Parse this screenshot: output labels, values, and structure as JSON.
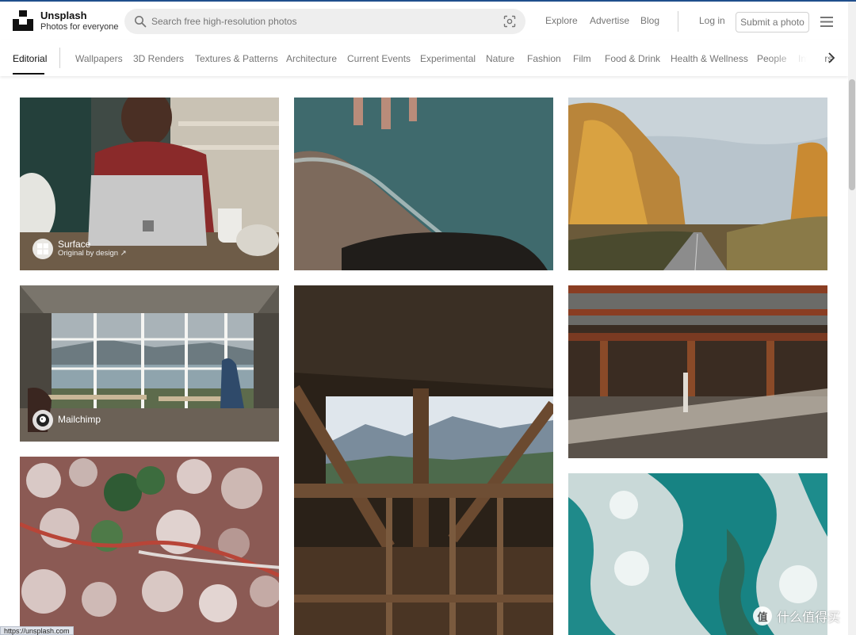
{
  "brand": {
    "name": "Unsplash",
    "tagline": "Photos for everyone"
  },
  "search": {
    "placeholder": "Search free high-resolution photos",
    "value": ""
  },
  "nav": {
    "explore": "Explore",
    "advertise": "Advertise",
    "blog": "Blog",
    "login": "Log in",
    "submit": "Submit a photo"
  },
  "topics": [
    "Editorial",
    "Wallpapers",
    "3D Renders",
    "Textures & Patterns",
    "Architecture",
    "Current Events",
    "Experimental",
    "Nature",
    "Fashion",
    "Film",
    "Food & Drink",
    "Health & Wellness",
    "People",
    "Interiors"
  ],
  "active_topic": "Editorial",
  "sponsors": {
    "surface": {
      "name": "Surface",
      "subtitle": "Original by design ↗"
    },
    "mailchimp": {
      "name": "Mailchimp"
    }
  },
  "photos": [
    {
      "name": "photo-surface-laptop",
      "sponsored": true
    },
    {
      "name": "photo-beach-water"
    },
    {
      "name": "photo-autumn-road"
    },
    {
      "name": "photo-mailchimp-office",
      "sponsored": true
    },
    {
      "name": "photo-wooden-tower"
    },
    {
      "name": "photo-industrial-hall"
    },
    {
      "name": "photo-aerial-forest"
    },
    {
      "name": "photo-ocean-waves"
    }
  ],
  "status_url": "https://unsplash.com",
  "watermark": {
    "symbol": "值",
    "text": "什么值得买"
  },
  "icons": {
    "logo": "unsplash-logo",
    "search": "search-icon",
    "visual_search": "visual-search-icon",
    "menu": "hamburger-menu-icon",
    "scroll": "chevron-right-icon"
  }
}
